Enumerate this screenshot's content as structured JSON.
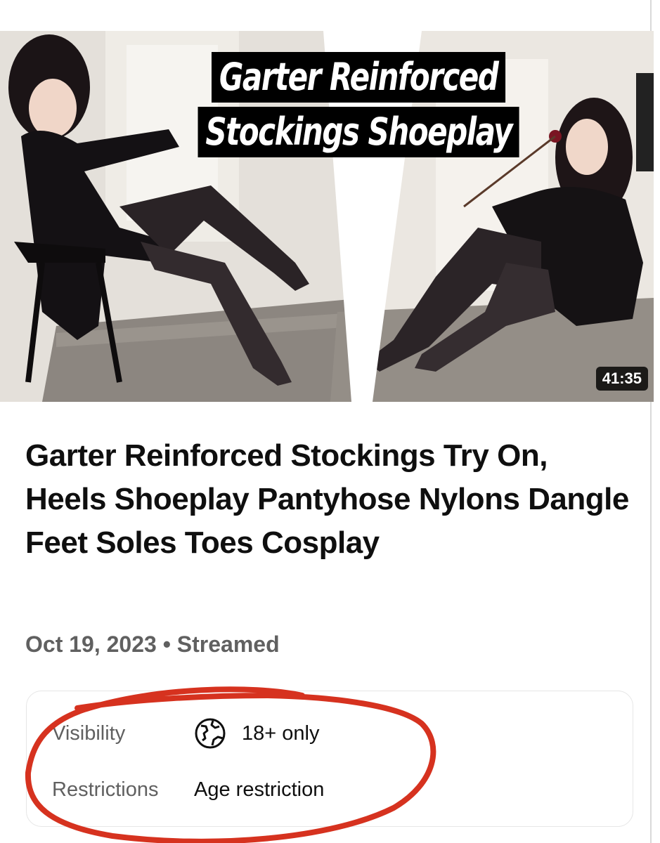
{
  "thumbnail": {
    "overlay_lines": [
      "Garter Reinforced",
      "Stockings Shoeplay"
    ],
    "duration": "41:35"
  },
  "video": {
    "title": "Garter Reinforced Stockings Try On, Heels Shoeplay Pantyhose Nylons Dangle Feet Soles Toes Cosplay",
    "date": "Oct 19, 2023",
    "separator": "•",
    "type": "Streamed"
  },
  "details": {
    "visibility_label": "Visibility",
    "visibility_value": "18+ only",
    "visibility_icon": "globe-icon",
    "restrictions_label": "Restrictions",
    "restrictions_value": "Age restriction"
  },
  "colors": {
    "annotation": "#d6321f",
    "meta_text": "#606060"
  }
}
